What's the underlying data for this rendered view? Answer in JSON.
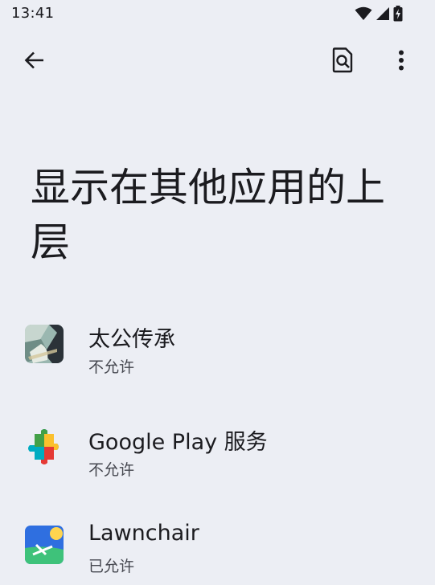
{
  "status_bar": {
    "time": "13:41",
    "icons": [
      "wifi-icon",
      "signal-icon",
      "battery-charging-icon"
    ]
  },
  "toolbar": {
    "back_icon": "back-arrow-icon",
    "search_icon": "search-settings-icon",
    "more_icon": "more-vert-icon"
  },
  "page": {
    "title": "显示在其他应用的上层"
  },
  "apps": [
    {
      "name": "太公传承",
      "status": "不允许",
      "icon": "taigong-app-icon"
    },
    {
      "name": "Google Play 服务",
      "status": "不允许",
      "icon": "google-play-services-icon"
    },
    {
      "name": "Lawnchair",
      "status": "已允许",
      "icon": "lawnchair-icon"
    }
  ],
  "colors": {
    "background": "#eceef4",
    "text_primary": "#1b1b1f",
    "text_secondary": "#45474f"
  }
}
